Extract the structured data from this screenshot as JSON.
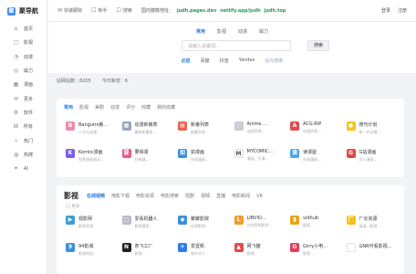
{
  "logo": "聚导航",
  "sidebar": [
    {
      "label": "首页",
      "icon": "⌂"
    },
    {
      "label": "影视",
      "icon": "▢"
    },
    {
      "label": "动漫",
      "icon": "◔"
    },
    {
      "label": "磁力",
      "icon": "◎"
    },
    {
      "label": "漫画",
      "icon": "▦"
    },
    {
      "label": "更多",
      "icon": "✉"
    },
    {
      "label": "软件",
      "icon": "⚙"
    },
    {
      "label": "所有",
      "icon": "⌘"
    },
    {
      "label": "热门",
      "icon": "✧"
    },
    {
      "label": "热搜",
      "icon": "◍"
    },
    {
      "label": "AI",
      "icon": "✦"
    }
  ],
  "topbar": {
    "links": [
      {
        "label": "快速跟踪",
        "icon": "✉"
      },
      {
        "label": "新手",
        "icon": "☐"
      },
      {
        "label": "搜索",
        "icon": "☐"
      }
    ],
    "mirror_label": "国内镜像地址：",
    "mirrors": [
      "judh.pages.dev",
      "netlify.app/judh",
      "judh.top"
    ],
    "login": "登录",
    "register": "注册"
  },
  "search": {
    "tabs": [
      "常用",
      "影视",
      "动漫",
      "磁力"
    ],
    "placeholder": "请输入关键词...",
    "button": "搜索",
    "engines": [
      "必应",
      "百度",
      "抖音",
      "Yandex",
      "站内搜索"
    ]
  },
  "stats": {
    "total": "站网站数：8205",
    "today": "今日新增：6"
  },
  "section1": {
    "tabs": [
      "常用",
      "影视",
      "美剧",
      "动漫",
      "评分",
      "收藏",
      "我的收藏"
    ],
    "sites": [
      {
        "name": "Bangumi番...",
        "desc": "二次元动漫...",
        "icon_color": "#f08aa9",
        "glyph": "B"
      },
      {
        "name": "动漫新番表",
        "desc": "最新新番表...",
        "icon_color": "#9aa6b8",
        "glyph": "▦"
      },
      {
        "name": "新番列表",
        "desc": "新番列表...",
        "icon_color": "#e8624f",
        "glyph": "▤"
      },
      {
        "name": "Anime ...",
        "desc": "动画资源...",
        "icon_color": "#c9ccd2",
        "glyph": "◌"
      },
      {
        "name": "ACG.RIP",
        "desc": "动漫资源...",
        "icon_color": "#e24a4a",
        "glyph": "A"
      },
      {
        "name": "搜刊计划",
        "desc": "新一代动漫...",
        "icon_color": "#f5c51a",
        "glyph": "●"
      },
      {
        "name": "Komiic漫画",
        "desc": "免费漫画阅读...",
        "icon_color": "#7a5cf0",
        "glyph": "K"
      },
      {
        "name": "要得漫",
        "desc": "日韩漫...",
        "icon_color": "#e95a8c",
        "glyph": "要"
      },
      {
        "name": "如漫画",
        "desc": "在线漫画...",
        "icon_color": "#3b8fe0",
        "glyph": "如"
      },
      {
        "name": "MYCOMIC...",
        "desc": "漫画、日漫...",
        "icon_color": "#f7f7f7",
        "glyph": "M"
      },
      {
        "name": "读漫屋",
        "desc": "在线漫画...",
        "icon_color": "#4fa3e8",
        "glyph": "读"
      },
      {
        "name": "G站漫画",
        "desc": "同人漫画...",
        "icon_color": "#e24a4a",
        "glyph": "G"
      }
    ]
  },
  "section2": {
    "title": "影视",
    "tabs": [
      "在线视频",
      "电影下载",
      "电影资源",
      "电影搜索",
      "短剧",
      "视频",
      "直播",
      "电影新闻",
      "VR"
    ],
    "note": "◯ 更多",
    "sites": [
      {
        "name": "观影网",
        "desc": "影视资源...",
        "icon_color": "#3aa0d8",
        "glyph": "▶"
      },
      {
        "name": "爱看机器人",
        "desc": "影视搜索...",
        "icon_color": "#b9bec7",
        "glyph": "▢"
      },
      {
        "name": "聚聚影院",
        "desc": "在线影院...",
        "icon_color": "#3b8fe0",
        "glyph": "◆"
      },
      {
        "name": "LIBVIO...",
        "desc": "在线视频影院...",
        "icon_color": "#f29b2a",
        "glyph": "L"
      },
      {
        "name": "vidhub",
        "desc": "影视...",
        "icon_color": "#e8a51a",
        "glyph": "▮"
      },
      {
        "name": "厂长资源",
        "desc": "高清...影视...",
        "icon_color": "#f2c21a",
        "glyph": "厂"
      },
      {
        "name": "94影城",
        "desc": "影视网站...",
        "icon_color": "#3b8fe0",
        "glyph": "9"
      },
      {
        "name": "奈飞工厂",
        "desc": "影视...",
        "icon_color": "#222222",
        "glyph": "N"
      },
      {
        "name": "爱壹帆",
        "desc": "海外华人...",
        "icon_color": "#2f7cf0",
        "glyph": "✈"
      },
      {
        "name": "网飞猫",
        "desc": "影视...",
        "icon_color": "#e24a4a",
        "glyph": "▲"
      },
      {
        "name": "Girry小电...",
        "desc": "影视...",
        "icon_color": "#e63b5a",
        "glyph": "G"
      },
      {
        "name": "GNR可看影视...",
        "desc": "",
        "icon_color": "#ffffff",
        "glyph": ""
      }
    ]
  }
}
